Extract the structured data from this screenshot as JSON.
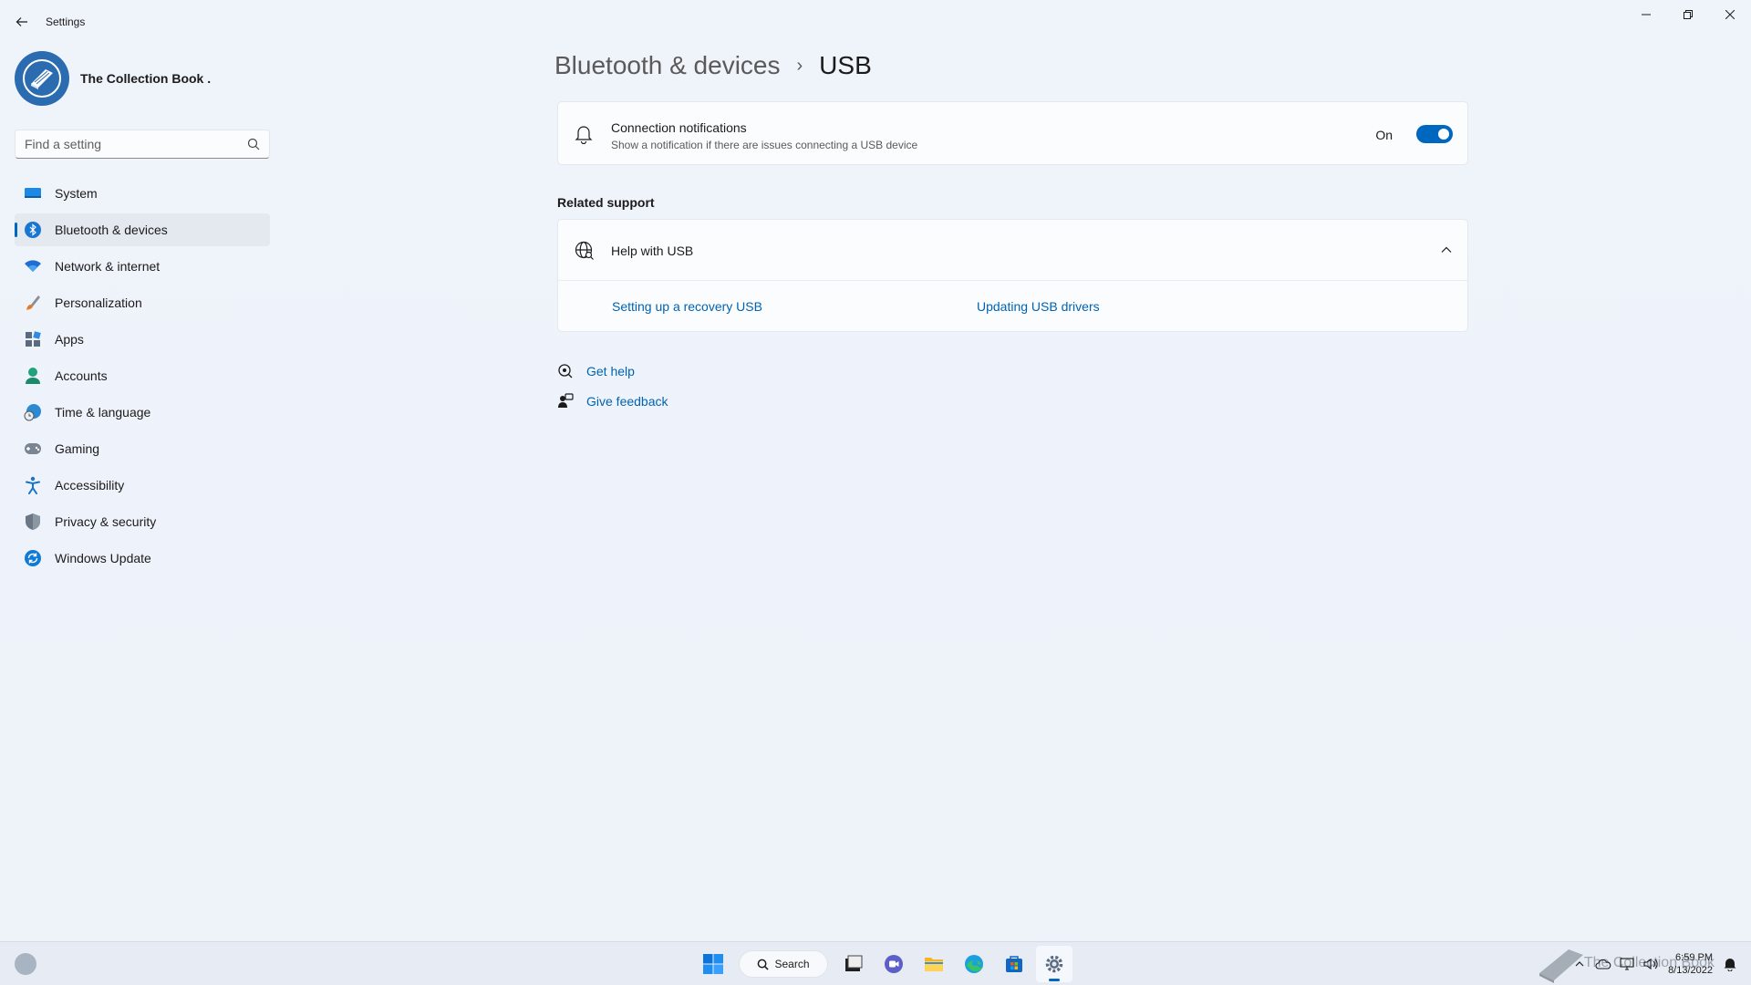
{
  "window": {
    "title": "Settings",
    "controls": {
      "minimize": "minimize-icon",
      "maximize": "restore-icon",
      "close": "close-icon"
    }
  },
  "profile": {
    "name": "The Collection Book ."
  },
  "search": {
    "placeholder": "Find a setting"
  },
  "sidebar": {
    "items": [
      {
        "label": "System",
        "icon": "system-icon",
        "color": "#0078d4"
      },
      {
        "label": "Bluetooth & devices",
        "icon": "bluetooth-icon",
        "color": "#0067c0",
        "active": true
      },
      {
        "label": "Network & internet",
        "icon": "wifi-icon",
        "color": "#0067c0"
      },
      {
        "label": "Personalization",
        "icon": "brush-icon",
        "color": "#e27d27"
      },
      {
        "label": "Apps",
        "icon": "apps-icon",
        "color": "#5a6b80"
      },
      {
        "label": "Accounts",
        "icon": "accounts-icon",
        "color": "#20a37c"
      },
      {
        "label": "Time & language",
        "icon": "globe-clock-icon",
        "color": "#2c8ad3"
      },
      {
        "label": "Gaming",
        "icon": "gamepad-icon",
        "color": "#7a8594"
      },
      {
        "label": "Accessibility",
        "icon": "accessibility-icon",
        "color": "#1a73c8"
      },
      {
        "label": "Privacy & security",
        "icon": "shield-icon",
        "color": "#6b7785"
      },
      {
        "label": "Windows Update",
        "icon": "update-icon",
        "color": "#0f7bd6"
      }
    ]
  },
  "breadcrumb": {
    "parent": "Bluetooth & devices",
    "current": "USB"
  },
  "notifications": {
    "title": "Connection notifications",
    "description": "Show a notification if there are issues connecting a USB device",
    "state_label": "On",
    "enabled": true
  },
  "related": {
    "title": "Related support",
    "help_title": "Help with USB",
    "links": [
      "Setting up a recovery USB",
      "Updating USB drivers"
    ]
  },
  "footer": {
    "get_help": "Get help",
    "give_feedback": "Give feedback"
  },
  "taskbar": {
    "search_label": "Search",
    "clock_time": "6:59 PM",
    "clock_date": "8/13/2022",
    "watermark_text": "The Collection Book"
  },
  "colors": {
    "accent": "#0067c0",
    "link": "#0063b1"
  }
}
